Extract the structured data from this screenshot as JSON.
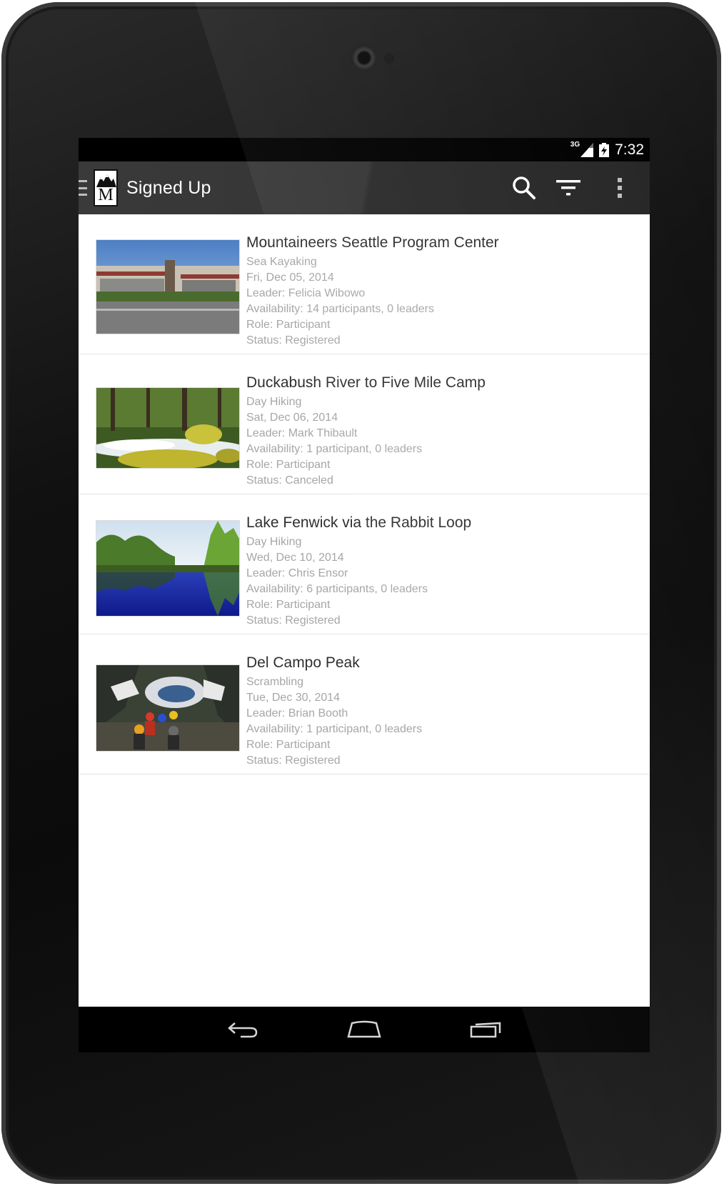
{
  "status_bar": {
    "network": "3G",
    "time": "7:32"
  },
  "action_bar": {
    "title": "Signed Up",
    "logo_letter": "M",
    "icons": [
      "drawer-icon",
      "search-icon",
      "filter-icon",
      "overflow-menu-icon"
    ]
  },
  "events": [
    {
      "title": "Mountaineers Seattle Program Center",
      "activity": "Sea Kayaking",
      "date": "Fri, Dec 05, 2014",
      "leader": "Leader: Felicia Wibowo",
      "availability": "Availability: 14 participants, 0 leaders",
      "role": "Role: Participant",
      "status": "Status: Registered",
      "image": "building-photo"
    },
    {
      "title": "Duckabush River to Five Mile Camp",
      "activity": "Day Hiking",
      "date": "Sat, Dec 06, 2014",
      "leader": "Leader: Mark Thibault",
      "availability": "Availability: 1 participant, 0 leaders",
      "role": "Role: Participant",
      "status": "Status: Canceled",
      "image": "river-photo"
    },
    {
      "title": "Lake Fenwick via the Rabbit Loop",
      "activity": "Day Hiking",
      "date": "Wed, Dec 10, 2014",
      "leader": "Leader: Chris Ensor",
      "availability": "Availability: 6 participants, 0 leaders",
      "role": "Role: Participant",
      "status": "Status: Registered",
      "image": "lake-photo"
    },
    {
      "title": "Del Campo Peak",
      "activity": "Scrambling",
      "date": "Tue, Dec 30, 2014",
      "leader": "Leader: Brian Booth",
      "availability": "Availability: 1 participant, 0 leaders",
      "role": "Role: Participant",
      "status": "Status: Registered",
      "image": "climbers-photo"
    }
  ],
  "nav_bar": {
    "icons": [
      "back-icon",
      "home-icon",
      "recents-icon"
    ]
  }
}
